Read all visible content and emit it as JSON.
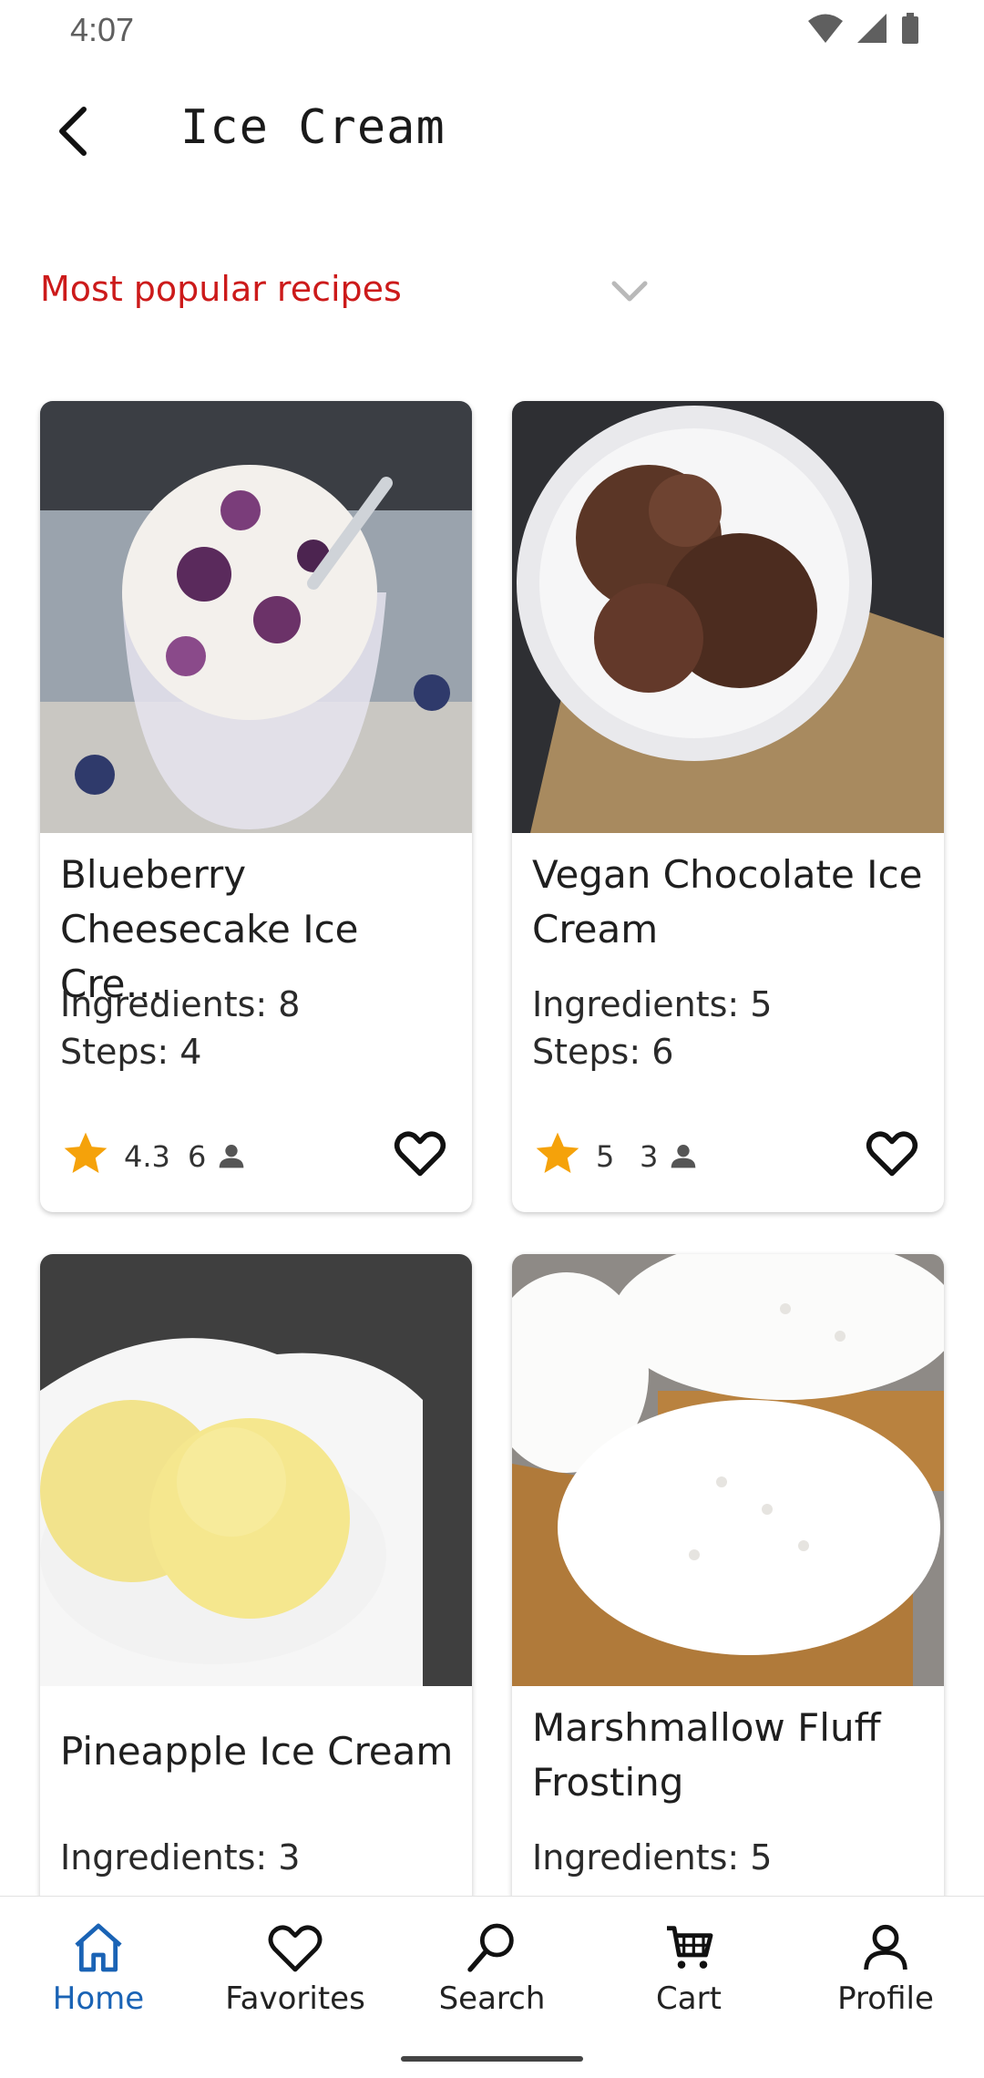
{
  "status": {
    "time": "4:07"
  },
  "header": {
    "title": "Ice Cream"
  },
  "sort": {
    "label": "Most popular recipes"
  },
  "recipes": [
    {
      "title": "Blueberry Cheesecake Ice Cre…",
      "ingredients": "Ingredients: 8",
      "steps": "Steps: 4",
      "rating": "4.3",
      "reviews": "6"
    },
    {
      "title": "Vegan Chocolate Ice Cream",
      "ingredients": "Ingredients: 5",
      "steps": "Steps: 6",
      "rating": "5",
      "reviews": "3"
    },
    {
      "title": "Pineapple Ice Cream",
      "ingredients": "Ingredients: 3",
      "steps": ""
    },
    {
      "title": "Marshmallow Fluff Frosting",
      "ingredients": "Ingredients: 5",
      "steps": ""
    }
  ],
  "nav": [
    {
      "label": "Home",
      "icon": "home-icon",
      "active": true
    },
    {
      "label": "Favorites",
      "icon": "heart-icon"
    },
    {
      "label": "Search",
      "icon": "search-icon"
    },
    {
      "label": "Cart",
      "icon": "cart-icon"
    },
    {
      "label": "Profile",
      "icon": "person-icon"
    }
  ],
  "colors": {
    "accent": "#cc1a1a",
    "nav_active": "#1a63b5",
    "star": "#f5a20a"
  }
}
